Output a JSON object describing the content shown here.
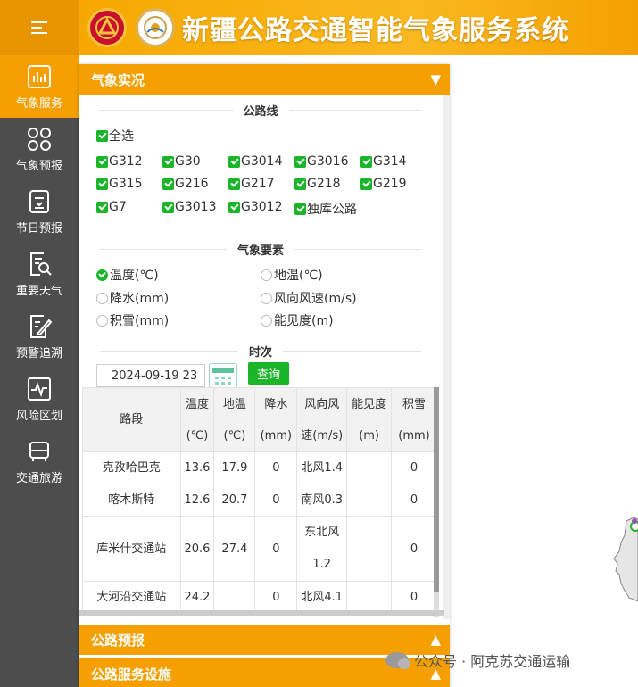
{
  "app": {
    "title": "新疆公路交通智能气象服务系统"
  },
  "sidebar": {
    "items": [
      {
        "label": "气象服务",
        "icon": "bar-chart-icon"
      },
      {
        "label": "气象预报",
        "icon": "grid-icon"
      },
      {
        "label": "节日预报",
        "icon": "document-icon"
      },
      {
        "label": "重要天气",
        "icon": "search-document-icon"
      },
      {
        "label": "预警追溯",
        "icon": "edit-icon"
      },
      {
        "label": "风险区划",
        "icon": "pulse-icon"
      },
      {
        "label": "交通旅游",
        "icon": "car-icon"
      }
    ]
  },
  "panel": {
    "title": "气象实况",
    "toggle": "▼",
    "roads_title": "公路线",
    "select_all": "全选",
    "roads": [
      "G312",
      "G30",
      "G3014",
      "G3016",
      "G314",
      "G315",
      "G216",
      "G217",
      "G218",
      "G219",
      "G7",
      "G3013",
      "G3012",
      "独库公路"
    ],
    "elements_title": "气象要素",
    "elements": [
      {
        "label": "温度(℃)",
        "selected": true
      },
      {
        "label": "地温(℃)",
        "selected": false
      },
      {
        "label": "降水(mm)",
        "selected": false
      },
      {
        "label": "风向风速(m/s)",
        "selected": false
      },
      {
        "label": "积雪(mm)",
        "selected": false
      },
      {
        "label": "能见度(m)",
        "selected": false
      }
    ],
    "time_title": "时次",
    "date_value": "2024-09-19 23",
    "query_label": "查询",
    "table": {
      "headers": [
        [
          "路段"
        ],
        [
          "温度",
          "(℃)"
        ],
        [
          "地温",
          "(℃)"
        ],
        [
          "降水",
          "(mm)"
        ],
        [
          "风向风",
          "速(m/s)"
        ],
        [
          "能见度",
          "(m)"
        ],
        [
          "积雪",
          "(mm)"
        ]
      ],
      "rows": [
        [
          "克孜哈巴克",
          "13.6",
          "17.9",
          "0",
          "北风1.4",
          "",
          "0"
        ],
        [
          "喀木斯特",
          "12.6",
          "20.7",
          "0",
          "南风0.3",
          "",
          "0"
        ],
        [
          "库米什交通站",
          "20.6",
          "27.4",
          "0",
          "东北风1.2",
          "",
          "0"
        ],
        [
          "大河沿交通站",
          "24.2",
          "",
          "0",
          "北风4.1",
          "",
          "0"
        ]
      ]
    }
  },
  "collapsed_panels": [
    {
      "title": "公路预报",
      "toggle": "▲"
    },
    {
      "title": "公路服务设施",
      "toggle": "▲"
    }
  ],
  "watermark": {
    "text": "公众号 · 阿克苏交通运输"
  },
  "colors": {
    "accent": "#f5a000",
    "sidebar": "#4d4d4d",
    "green": "#1bb52a"
  }
}
